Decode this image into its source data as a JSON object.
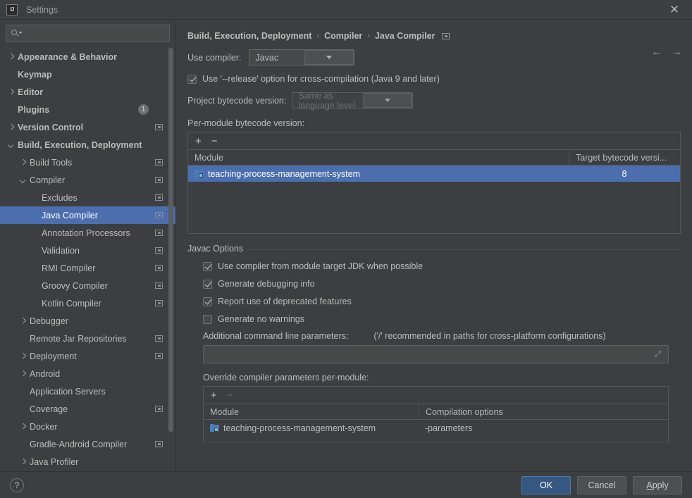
{
  "window": {
    "title": "Settings",
    "logo_text": "IJ",
    "close_label": "✕"
  },
  "search": {
    "value": "",
    "placeholder": ""
  },
  "sidebar": {
    "items": [
      {
        "label": "Appearance & Behavior",
        "indent": 0,
        "arrow": "right",
        "bold": true,
        "link": false,
        "badge": null,
        "selected": false
      },
      {
        "label": "Keymap",
        "indent": 0,
        "arrow": "none",
        "bold": true,
        "link": false,
        "badge": null,
        "selected": false
      },
      {
        "label": "Editor",
        "indent": 0,
        "arrow": "right",
        "bold": true,
        "link": false,
        "badge": null,
        "selected": false
      },
      {
        "label": "Plugins",
        "indent": 0,
        "arrow": "none",
        "bold": true,
        "link": false,
        "badge": "1",
        "selected": false
      },
      {
        "label": "Version Control",
        "indent": 0,
        "arrow": "right",
        "bold": true,
        "link": true,
        "badge": null,
        "selected": false
      },
      {
        "label": "Build, Execution, Deployment",
        "indent": 0,
        "arrow": "down",
        "bold": true,
        "link": false,
        "badge": null,
        "selected": false
      },
      {
        "label": "Build Tools",
        "indent": 1,
        "arrow": "right",
        "bold": false,
        "link": true,
        "badge": null,
        "selected": false
      },
      {
        "label": "Compiler",
        "indent": 1,
        "arrow": "down",
        "bold": false,
        "link": true,
        "badge": null,
        "selected": false
      },
      {
        "label": "Excludes",
        "indent": 2,
        "arrow": "none",
        "bold": false,
        "link": true,
        "badge": null,
        "selected": false
      },
      {
        "label": "Java Compiler",
        "indent": 2,
        "arrow": "none",
        "bold": false,
        "link": true,
        "badge": null,
        "selected": true
      },
      {
        "label": "Annotation Processors",
        "indent": 2,
        "arrow": "none",
        "bold": false,
        "link": true,
        "badge": null,
        "selected": false
      },
      {
        "label": "Validation",
        "indent": 2,
        "arrow": "none",
        "bold": false,
        "link": true,
        "badge": null,
        "selected": false
      },
      {
        "label": "RMI Compiler",
        "indent": 2,
        "arrow": "none",
        "bold": false,
        "link": true,
        "badge": null,
        "selected": false
      },
      {
        "label": "Groovy Compiler",
        "indent": 2,
        "arrow": "none",
        "bold": false,
        "link": true,
        "badge": null,
        "selected": false
      },
      {
        "label": "Kotlin Compiler",
        "indent": 2,
        "arrow": "none",
        "bold": false,
        "link": true,
        "badge": null,
        "selected": false
      },
      {
        "label": "Debugger",
        "indent": 1,
        "arrow": "right",
        "bold": false,
        "link": false,
        "badge": null,
        "selected": false
      },
      {
        "label": "Remote Jar Repositories",
        "indent": 1,
        "arrow": "none",
        "bold": false,
        "link": true,
        "badge": null,
        "selected": false
      },
      {
        "label": "Deployment",
        "indent": 1,
        "arrow": "right",
        "bold": false,
        "link": true,
        "badge": null,
        "selected": false
      },
      {
        "label": "Android",
        "indent": 1,
        "arrow": "right",
        "bold": false,
        "link": false,
        "badge": null,
        "selected": false
      },
      {
        "label": "Application Servers",
        "indent": 1,
        "arrow": "none",
        "bold": false,
        "link": false,
        "badge": null,
        "selected": false
      },
      {
        "label": "Coverage",
        "indent": 1,
        "arrow": "none",
        "bold": false,
        "link": true,
        "badge": null,
        "selected": false
      },
      {
        "label": "Docker",
        "indent": 1,
        "arrow": "right",
        "bold": false,
        "link": false,
        "badge": null,
        "selected": false
      },
      {
        "label": "Gradle-Android Compiler",
        "indent": 1,
        "arrow": "none",
        "bold": false,
        "link": true,
        "badge": null,
        "selected": false
      },
      {
        "label": "Java Profiler",
        "indent": 1,
        "arrow": "right",
        "bold": false,
        "link": false,
        "badge": null,
        "selected": false
      }
    ]
  },
  "breadcrumb": {
    "parts": [
      "Build, Execution, Deployment",
      "Compiler",
      "Java Compiler"
    ],
    "separator": "›"
  },
  "nav": {
    "back": "←",
    "forward": "→"
  },
  "main": {
    "use_compiler_label": "Use compiler:",
    "use_compiler_value": "Javac",
    "release_option_label": "Use '--release' option for cross-compilation (Java 9 and later)",
    "release_option_checked": true,
    "project_bytecode_label": "Project bytecode version:",
    "project_bytecode_value": "Same as language level",
    "per_module_label": "Per-module bytecode version:",
    "add_button": "+",
    "remove_button": "−",
    "bytecode_table": {
      "columns": [
        "Module",
        "Target bytecode versi..."
      ],
      "rows": [
        {
          "module": "teaching-process-management-system",
          "version": "8",
          "selected": true
        }
      ]
    },
    "javac_options_title": "Javac Options",
    "javac_checkboxes": [
      {
        "label": "Use compiler from module target JDK when possible",
        "checked": true
      },
      {
        "label": "Generate debugging info",
        "checked": true
      },
      {
        "label": "Report use of deprecated features",
        "checked": true
      },
      {
        "label": "Generate no warnings",
        "checked": false
      }
    ],
    "additional_params_label": "Additional command line parameters:",
    "additional_params_hint": "('/' recommended in paths for cross-platform configurations)",
    "additional_params_value": "",
    "expand_icon": "⤢",
    "override_label": "Override compiler parameters per-module:",
    "override_add_button": "+",
    "override_remove_button": "−",
    "override_table": {
      "columns": [
        "Module",
        "Compilation options"
      ],
      "rows": [
        {
          "module": "teaching-process-management-system",
          "options": "-parameters",
          "selected": false
        }
      ]
    }
  },
  "footer": {
    "help": "?",
    "ok": "OK",
    "cancel": "Cancel",
    "apply_prefix": "A",
    "apply_rest": "pply"
  },
  "colors": {
    "accent": "#4b6eaf",
    "primary_button": "#365880",
    "background": "#3c3f41",
    "module_icon": "#4a7eb8"
  }
}
